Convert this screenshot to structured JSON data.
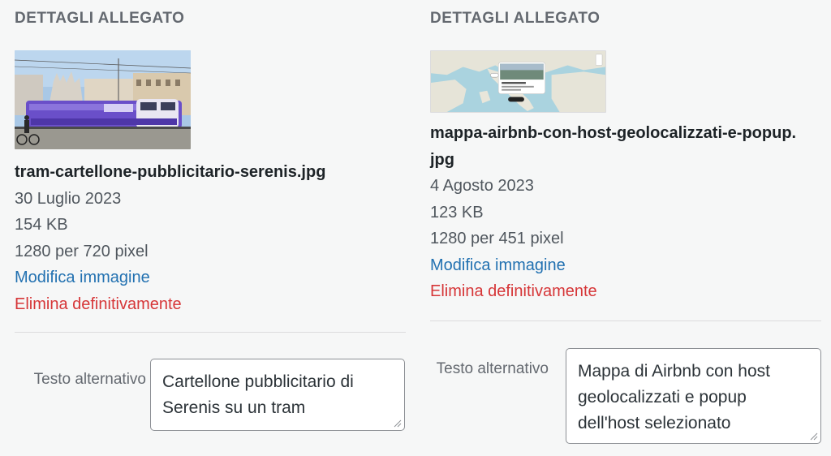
{
  "attachments": [
    {
      "heading": "DETTAGLI ALLEGATO",
      "thumbnail": "tram-image",
      "filename": "tram-cartellone-pubblicitario-serenis.jpg",
      "date": "30 Luglio 2023",
      "size": "154 KB",
      "dimensions": "1280 per 720 pixel",
      "edit_label": "Modifica immagine",
      "delete_label": "Elimina definitivamente",
      "alt_label": "Testo alternativo",
      "alt_value": "Cartellone pubblicitario di Serenis su un tram"
    },
    {
      "heading": "DETTAGLI ALLEGATO",
      "thumbnail": "map-image",
      "filename": "mappa-airbnb-con-host-geolocalizzati-e-popup.jpg",
      "date": "4 Agosto 2023",
      "size": "123 KB",
      "dimensions": "1280 per 451 pixel",
      "edit_label": "Modifica immagine",
      "delete_label": "Elimina definitivamente",
      "alt_label": "Testo alternativo",
      "alt_value": "Mappa di Airbnb con host geolocalizzati e popup dell'host selezionato"
    }
  ],
  "colors": {
    "link": "#2271b1",
    "delete": "#d63638",
    "heading": "#646970"
  }
}
